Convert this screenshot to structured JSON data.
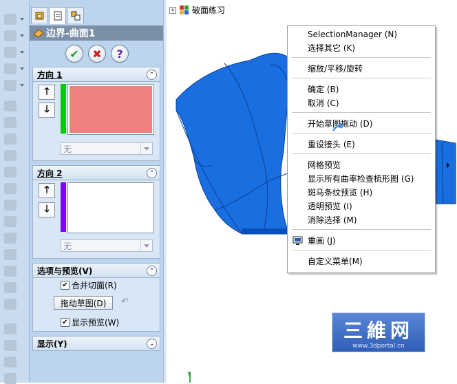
{
  "feature": {
    "title": "边界-曲面1"
  },
  "actions": {
    "ok": "✔",
    "cancel": "✖",
    "help": "?"
  },
  "direction1": {
    "title": "方向 1",
    "combo_value": "无",
    "highlight_color": "#f08080",
    "bar_color": "#00cc00"
  },
  "direction2": {
    "title": "方向 2",
    "combo_value": "无",
    "bar_color": "#8000ff"
  },
  "options": {
    "title": "选项与预览(V)",
    "merge_label": "合并切面(R)",
    "merge_checked": "✔",
    "drag_sketch_button": "拖动草图(D)",
    "undo_icon": "↶",
    "show_preview_label": "显示预览(W)",
    "show_preview_checked": "✔"
  },
  "display": {
    "title": "显示(Y)"
  },
  "tree": {
    "root_label": "破面练习",
    "expand": "+"
  },
  "context_menu": {
    "items": [
      {
        "label": "SelectionManager  (N)"
      },
      {
        "label": "选择其它  (K)"
      },
      {
        "label": "缩放/平移/旋转"
      },
      {
        "label": "确定  (B)"
      },
      {
        "label": "取消  (C)"
      },
      {
        "label": "开始草图拖动  (D)"
      },
      {
        "label": "重设接头  (E)"
      },
      {
        "label": "网格预览"
      },
      {
        "label": "显示所有曲率检查梳形图  (G)"
      },
      {
        "label": "斑马条纹预览  (H)"
      },
      {
        "label": "透明预览  (I)"
      },
      {
        "label": "消除选择  (M)"
      },
      {
        "label": "重画  (J)"
      },
      {
        "label": "自定义菜单(M)"
      }
    ]
  },
  "watermark": {
    "title": "三維网",
    "url": "www.3dportal.cn"
  },
  "colors": {
    "model_blue": "#1a6fe0",
    "model_dark": "#0a3f9a",
    "panel_bg": "#bcd4ec"
  }
}
